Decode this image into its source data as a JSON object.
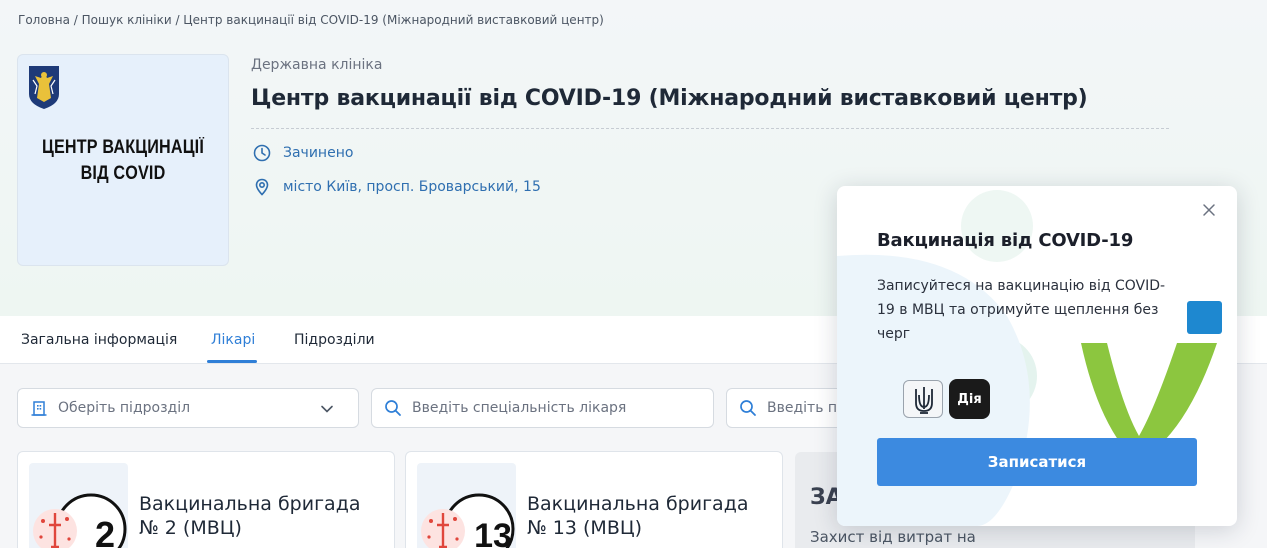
{
  "breadcrumb": {
    "home": "Головна",
    "search": "Пошук клініки",
    "current": "Центр вакцинації від COVID-19 (Міжнародний виставковий центр)",
    "separator": " / "
  },
  "clinic": {
    "logo_line1": "ЦЕНТР ВАКЦИНАЦІЇ",
    "logo_line2": "ВІД COVID",
    "type": "Державна клініка",
    "name": "Центр вакцинації від COVID-19 (Міжнародний виставковий центр)",
    "status": "Зачинено",
    "address": "місто Київ, просп. Броварський, 15"
  },
  "tabs": [
    {
      "label": "Загальна інформація",
      "active": false
    },
    {
      "label": "Лікарі",
      "active": true
    },
    {
      "label": "Підрозділи",
      "active": false
    }
  ],
  "filters": {
    "department_placeholder": "Оберіть підрозділ",
    "specialty_placeholder": "Введіть спеціальність лікаря",
    "name_placeholder": "Введіть пр"
  },
  "cards": [
    {
      "number": "2",
      "title_line1": "Вакцинальна бригада",
      "title_line2": "№ 2 (МВЦ)"
    },
    {
      "number": "13",
      "title_line1": "Вакцинальна бригада",
      "title_line2": "№ 13 (МВЦ)"
    }
  ],
  "promo_card": {
    "heading": "ЗА",
    "subtitle": "Захист від витрат на"
  },
  "popup": {
    "title": "Вакцинація від COVID-19",
    "text": "Записуйтеся на вакцинацію від COVID-19 в МВЦ та отримуйте щеплення без черг",
    "diia_label": "Дія",
    "button_label": "Записатися"
  },
  "colors": {
    "accent": "#2f7fd7",
    "button": "#3c8ae0",
    "link_text": "#2f6fb0",
    "lime": "#8cc63f"
  }
}
